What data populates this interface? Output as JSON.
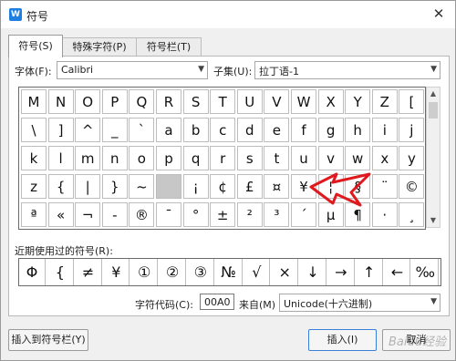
{
  "window": {
    "title": "符号",
    "app_icon_letter": "W",
    "close_glyph": "✕"
  },
  "tabs": [
    {
      "label": "符号(S)",
      "active": true
    },
    {
      "label": "特殊字符(P)",
      "active": false
    },
    {
      "label": "符号栏(T)",
      "active": false
    }
  ],
  "font": {
    "label": "字体(F):",
    "value": "Calibri"
  },
  "subset": {
    "label": "子集(U):",
    "value": "拉丁语-1"
  },
  "symbol_grid": {
    "rows": [
      [
        "M",
        "N",
        "O",
        "P",
        "Q",
        "R",
        "S",
        "T",
        "U",
        "V",
        "W",
        "X",
        "Y",
        "Z",
        "["
      ],
      [
        "\\",
        "]",
        "^",
        "_",
        "`",
        "a",
        "b",
        "c",
        "d",
        "e",
        "f",
        "g",
        "h",
        "i",
        "j"
      ],
      [
        "k",
        "l",
        "m",
        "n",
        "o",
        "p",
        "q",
        "r",
        "s",
        "t",
        "u",
        "v",
        "w",
        "x",
        "y"
      ],
      [
        "z",
        "{",
        "|",
        "}",
        "~",
        "",
        "¡",
        "¢",
        "£",
        "¤",
        "¥",
        "¦",
        "§",
        "¨",
        "©"
      ],
      [
        "ª",
        "«",
        "¬",
        "-",
        "®",
        "¯",
        "°",
        "±",
        "²",
        "³",
        "´",
        "µ",
        "¶",
        "·",
        "¸"
      ]
    ],
    "selected": {
      "row": 3,
      "col": 5
    }
  },
  "recent": {
    "label": "近期使用过的符号(R):",
    "symbols": [
      "Φ",
      "{",
      "≠",
      "¥",
      "①",
      "②",
      "③",
      "№",
      "√",
      "×",
      "↓",
      "→",
      "↑",
      "←",
      "‰"
    ]
  },
  "char_code": {
    "label": "字符代码(C):",
    "value": "00A0"
  },
  "from": {
    "label": "来自(M)",
    "value": "Unicode(十六进制)"
  },
  "buttons": {
    "insert_to_bar": "插入到符号栏(Y)",
    "insert": "插入(I)",
    "cancel": "取消"
  },
  "annotation": {
    "color": "#e0191e"
  },
  "watermark": "Baidu经验"
}
